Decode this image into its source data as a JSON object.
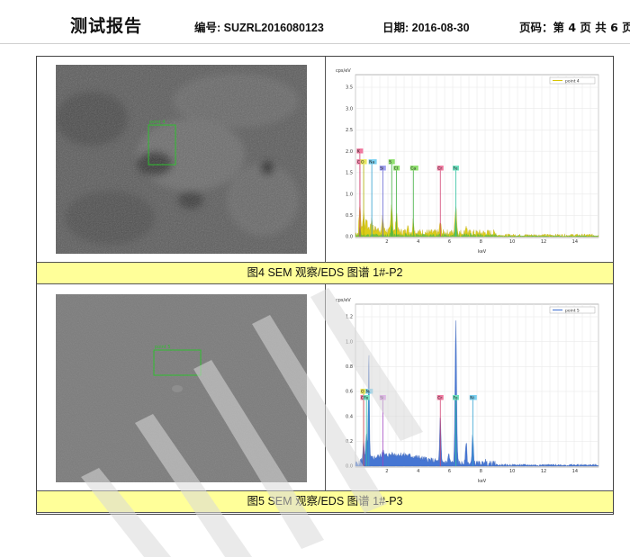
{
  "header": {
    "title": "测试报告",
    "report_number": "编号: SUZRL2016080123",
    "date": "日期: 2016-08-30",
    "page_info": "页码：第 4 页 共 6 页"
  },
  "figures": [
    {
      "caption": "图4    SEM 观察/EDS 图谱 1#-P2",
      "sem_label": "point 4",
      "spectrum": {
        "ylabel": "cps/eV",
        "xlabel": "keV",
        "legend": "point 4",
        "yticks": [
          "0.0",
          "0.5",
          "1.0",
          "1.5",
          "2.0",
          "2.5",
          "3.0",
          "3.5"
        ],
        "xticks": [
          "2",
          "4",
          "6",
          "8",
          "10",
          "12",
          "14"
        ],
        "element_labels": [
          "K",
          "C",
          "O",
          "Na",
          "S",
          "Cl",
          "Si",
          "Ca",
          "Cr",
          "Fe"
        ]
      }
    },
    {
      "caption": "图5    SEM 观察/EDS 图谱 1#-P3",
      "sem_label": "point 5",
      "spectrum": {
        "ylabel": "cps/eV",
        "xlabel": "keV",
        "legend": "point 5",
        "yticks": [
          "0.0",
          "0.2",
          "0.4",
          "0.6",
          "0.8",
          "1.0",
          "1.2"
        ],
        "xticks": [
          "2",
          "4",
          "6",
          "8",
          "10",
          "12",
          "14"
        ],
        "element_labels": [
          "O",
          "Ni",
          "Cr",
          "Si",
          "Fe",
          "Fe"
        ]
      }
    }
  ],
  "colors": {
    "caption_bg": "#ffff99",
    "sem_box": "#2fbf2f",
    "spectrum_blue": "#3d6fd1",
    "spectrum_yellow": "#d7c400"
  }
}
